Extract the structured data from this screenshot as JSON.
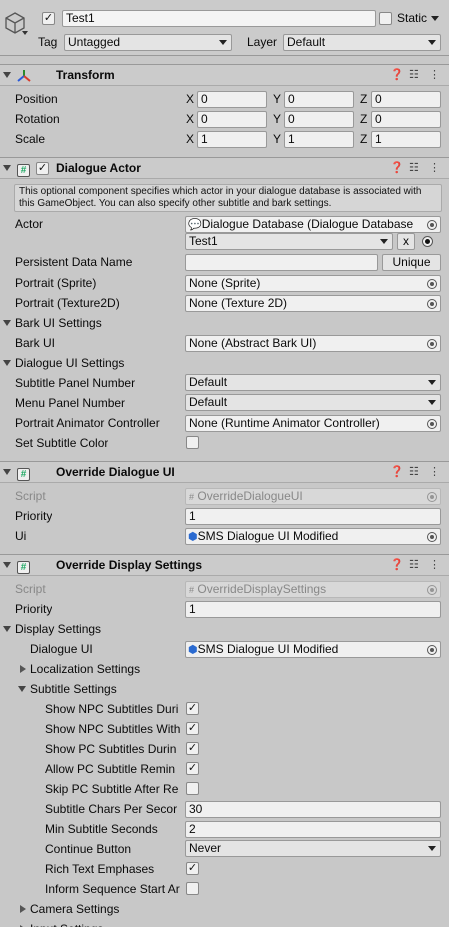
{
  "object": {
    "name": "Test1",
    "static_label": "Static",
    "tag_label": "Tag",
    "tag_value": "Untagged",
    "layer_label": "Layer",
    "layer_value": "Default"
  },
  "transform": {
    "title": "Transform",
    "position_label": "Position",
    "rotation_label": "Rotation",
    "scale_label": "Scale",
    "x": "X",
    "y": "Y",
    "z": "Z",
    "position": [
      "0",
      "0",
      "0"
    ],
    "rotation": [
      "0",
      "0",
      "0"
    ],
    "scale": [
      "1",
      "1",
      "1"
    ]
  },
  "dialogue_actor": {
    "title": "Dialogue Actor",
    "help": "This optional component specifies which actor in your dialogue database is associated with this GameObject. You can also specify other subtitle and bark settings.",
    "actor_label": "Actor",
    "actor_db": "Dialogue Database (Dialogue Database",
    "actor_value": "Test1",
    "actor_x": "x",
    "persistent_label": "Persistent Data Name",
    "persistent_value": "",
    "unique_btn": "Unique",
    "portrait_sprite_label": "Portrait (Sprite)",
    "portrait_sprite_value": "None (Sprite)",
    "portrait_tex_label": "Portrait (Texture2D)",
    "portrait_tex_value": "None (Texture 2D)",
    "bark_settings_label": "Bark UI Settings",
    "bark_ui_label": "Bark UI",
    "bark_ui_value": "None (Abstract Bark UI)",
    "dialogue_ui_settings_label": "Dialogue UI Settings",
    "subtitle_panel_label": "Subtitle Panel Number",
    "subtitle_panel_value": "Default",
    "menu_panel_label": "Menu Panel Number",
    "menu_panel_value": "Default",
    "portrait_anim_label": "Portrait Animator Controller",
    "portrait_anim_value": "None (Runtime Animator Controller)",
    "set_color_label": "Set Subtitle Color"
  },
  "override_ui": {
    "title": "Override Dialogue UI",
    "script_label": "Script",
    "script_value": "OverrideDialogueUI",
    "priority_label": "Priority",
    "priority_value": "1",
    "ui_label": "Ui",
    "ui_value": "SMS Dialogue UI Modified"
  },
  "override_display": {
    "title": "Override Display Settings",
    "script_label": "Script",
    "script_value": "OverrideDisplaySettings",
    "priority_label": "Priority",
    "priority_value": "1",
    "display_settings_label": "Display Settings",
    "dialogue_ui_label": "Dialogue UI",
    "dialogue_ui_value": "SMS Dialogue UI Modified",
    "localization_label": "Localization Settings",
    "subtitle_settings_label": "Subtitle Settings",
    "show_npc_during": "Show NPC Subtitles Duri",
    "show_npc_with": "Show NPC Subtitles With",
    "show_pc_during": "Show PC Subtitles Durin",
    "allow_pc_remind": "Allow PC Subtitle Remin",
    "skip_pc_after": "Skip PC Subtitle After Re",
    "chars_per_sec_label": "Subtitle Chars Per Secor",
    "chars_per_sec_value": "30",
    "min_seconds_label": "Min Subtitle Seconds",
    "min_seconds_value": "2",
    "continue_label": "Continue Button",
    "continue_value": "Never",
    "rich_text_label": "Rich Text Emphases",
    "inform_label": "Inform Sequence Start Ar",
    "camera_settings_label": "Camera Settings",
    "input_settings_label": "Input Settings"
  },
  "checkmark": "✓"
}
